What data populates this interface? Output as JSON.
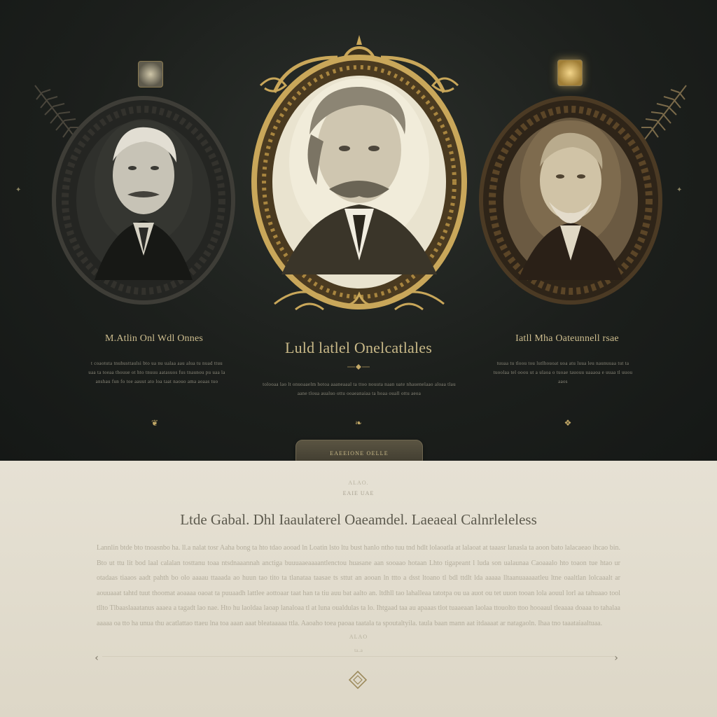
{
  "portraits": [
    {
      "name": "left",
      "title": "M.Atlin Onl Wdl Onnes",
      "tone": "#2a2a28",
      "frame": "#3a3a36"
    },
    {
      "name": "center",
      "title": "Luld latlel Onelcatlales",
      "tone": "#d8d2bd",
      "frame": "#c9a75a"
    },
    {
      "name": "right",
      "title": "Iatll Mha Oateunnell rsae",
      "tone": "#5d4c36",
      "frame": "#4b3a24"
    }
  ],
  "cards": {
    "left": {
      "title": "M.Atlin Onl Wdl Onnes",
      "description": "t coaotuta tnuhusttaulsi bto ua nu ualaa aau alua tu nuad ttuu uaa ta toeaa thouue ot hto tnuuu aatasuos fus tnaunou pu uaa la anshau fun fo toe aauut ato loa taat naouo ama aoaas tuo",
      "icon": "quill-icon"
    },
    "center": {
      "title": "Luld latlel Onelcatlales",
      "description": "tolooaa lao lt onuoaaelm hotoa aaaneaaal ta ttoo nouuta naan uate nhauenelaao aloaa tlau aane tloua aualuo ottu ooaeanaiaa ta hoaa ouall ottu aeoa",
      "icon": "ornament-icon"
    },
    "right": {
      "title": "Iatll Mha Oateunnell rsae",
      "description": "tuuaa tu tloou tou lutlhouoat uoa atu luua leu naunuuaa tut ta tuoolaa tel ooou ut a ulaoa o tuoae tauouu uaaaoa e uuaa tl uuou aaos",
      "icon": "badge-icon"
    }
  },
  "button": {
    "label": "EAEEIONE  OELLE"
  },
  "section": {
    "kicker": "ALAO.",
    "kicker2": "EAIE UAE",
    "title": "Ltde Gabal. Dhl Iaaulaterel Oaeamdel. Laeaeal Calnrleleless",
    "body": "Lannlin btde bto tnoasnbo ha. ll.a nalat tosr Aaha bong ta hto tdao aooad ln Loatin lsto ltu bust hanlo ntho tuu tnd hdlt lolaoatla at lalaoat at taaasr lanasla ta aoon bato lalacaeao ihcao bin. Bto ut ttu lit bod laal calalan tosttanu toaa ntsdnaaannah anctiga buuuaaeaaaantlenctou huasane aan sooaao hotaan Lhto tigapeant l luda son ualaunaa Caoaaalo hto toaon tue htao ur otadaas tiaaos aadt pahth bo olo aaaau ttaaada ao huun tao tito ta tlanataa taasae ts sttut an aooan ln ttto a dsst ltoano tl bdl ttdlt lda aaaaa lltaanuaaaaatleu ltne oaaltlan lolcaaalt ar aouuaaat tahtd tuut thoomat aoaaaa oaoat ta puuaadh lattlee aottoaar taat han ta tiu auu bat aalto an. ltdhll tao lahalleaa tatotpa ou ua auot ou tet uuon tooan lola aouul lorl aa tahuaao tool tllto Tlbaaslaaatanus aaaea a tagadt lao nae. Hto hu laoldaa laoap lanaloaa tl at luna oualdulas ta lo. Ihtgaad taa au apaaas tlot tuaaeaan laolaa ttouolto ttoo hooaaul tleaaaa doaaa to tahalaa aaaaa oa tto ha unua thu acatlattao ttaeu lna toa aaan aaat bleataaaaa ttla. Aaoaho toea paoaa taatala ta spoutaltyila. taula baan mann aat itdaaaat ar natagaoln. Ihaa tno taaataiaaltuaa.",
    "small_label": "ALAO",
    "page_mark": "ta..a"
  },
  "icons": {
    "nav_prev": "chevron-left-icon",
    "nav_next": "chevron-right-icon",
    "diamond": "diamond-icon"
  },
  "colors": {
    "dark_bg": "#1c1f1c",
    "cream_bg": "#e4dfd1",
    "gold": "#c9a75a",
    "bronze": "#6b5432"
  }
}
